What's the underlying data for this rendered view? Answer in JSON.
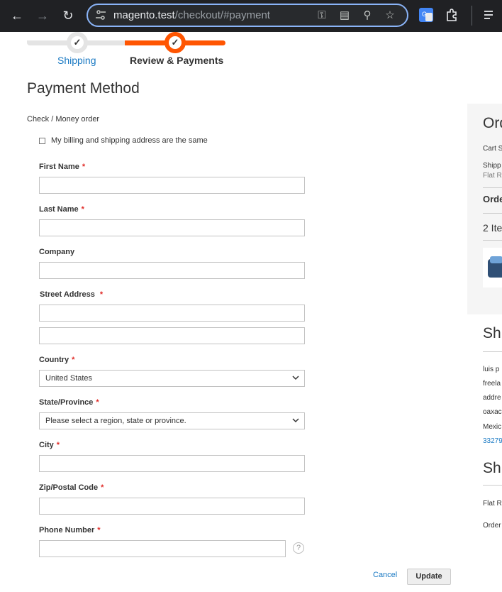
{
  "browser": {
    "url_host": "magento.test",
    "url_path": "/checkout/#payment"
  },
  "progress": {
    "steps": [
      {
        "label": "Shipping",
        "state": "complete"
      },
      {
        "label": "Review & Payments",
        "state": "active"
      }
    ]
  },
  "payment": {
    "title": "Payment Method",
    "method_label": "Check / Money order",
    "same_address_label": "My billing and shipping address are the same",
    "same_address_checked": false
  },
  "form": {
    "first_name": {
      "label": "First Name",
      "value": ""
    },
    "last_name": {
      "label": "Last Name",
      "value": ""
    },
    "company": {
      "label": "Company",
      "value": ""
    },
    "street": {
      "label": "Street Address",
      "line1": "",
      "line2": ""
    },
    "country": {
      "label": "Country",
      "value": "United States"
    },
    "region": {
      "label": "State/Province",
      "value": "Please select a region, state or province."
    },
    "city": {
      "label": "City",
      "value": ""
    },
    "zip": {
      "label": "Zip/Postal Code",
      "value": ""
    },
    "phone": {
      "label": "Phone Number",
      "value": ""
    },
    "required_mark": "*",
    "cancel_label": "Cancel",
    "update_label": "Update"
  },
  "summary": {
    "title": "Ord",
    "cart_line": "Cart S",
    "shipping_line": "Shipp",
    "shipping_method": "Flat R",
    "order_total": "Orde",
    "items": "2 Ite"
  },
  "ship_to": {
    "title": "Shi",
    "lines": [
      "luis p",
      "freela",
      "addre",
      "oaxac",
      "Mexic"
    ],
    "phone": "33279"
  },
  "ship_method": {
    "title": "Shi",
    "method": "Flat R",
    "order_line": "Order"
  },
  "colors": {
    "accent": "#ff5501",
    "link": "#1979c3",
    "required": "#e02b27"
  }
}
